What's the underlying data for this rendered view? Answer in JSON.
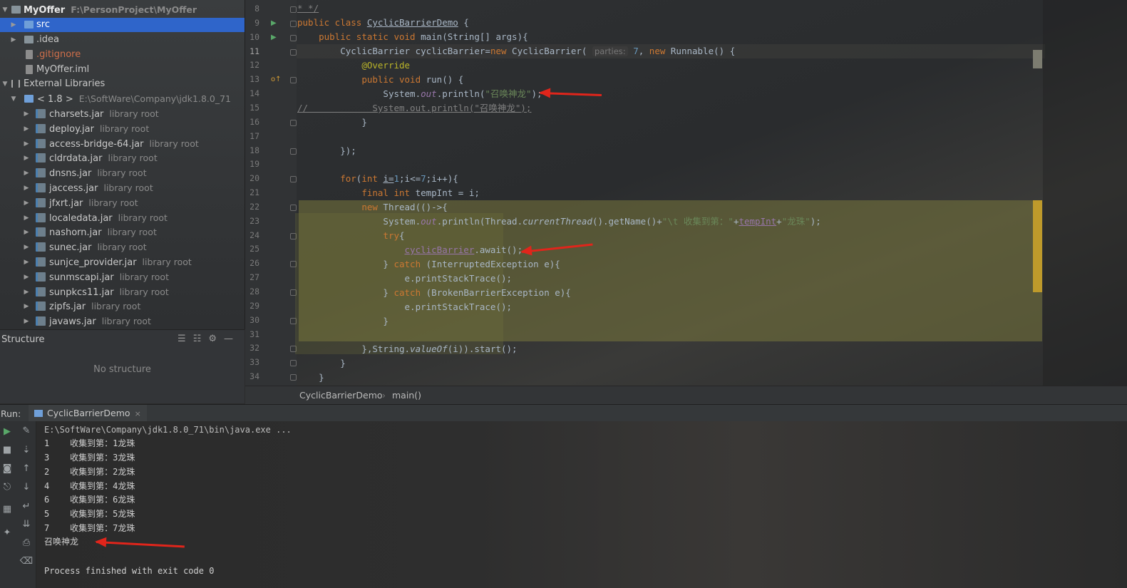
{
  "project": {
    "root_name": "MyOffer",
    "root_path": "F:\\PersonProject\\MyOffer",
    "items": [
      {
        "label": "src",
        "path": ""
      },
      {
        "label": ".idea",
        "path": ""
      },
      {
        "label": ".gitignore",
        "path": ""
      },
      {
        "label": "MyOffer.iml",
        "path": ""
      },
      {
        "label": "External Libraries",
        "path": ""
      },
      {
        "label": "< 1.8 >",
        "path": "E:\\SoftWare\\Company\\jdk1.8.0_71"
      }
    ],
    "jars": [
      {
        "label": "charsets.jar",
        "tag": "library root"
      },
      {
        "label": "deploy.jar",
        "tag": "library root"
      },
      {
        "label": "access-bridge-64.jar",
        "tag": "library root"
      },
      {
        "label": "cldrdata.jar",
        "tag": "library root"
      },
      {
        "label": "dnsns.jar",
        "tag": "library root"
      },
      {
        "label": "jaccess.jar",
        "tag": "library root"
      },
      {
        "label": "jfxrt.jar",
        "tag": "library root"
      },
      {
        "label": "localedata.jar",
        "tag": "library root"
      },
      {
        "label": "nashorn.jar",
        "tag": "library root"
      },
      {
        "label": "sunec.jar",
        "tag": "library root"
      },
      {
        "label": "sunjce_provider.jar",
        "tag": "library root"
      },
      {
        "label": "sunmscapi.jar",
        "tag": "library root"
      },
      {
        "label": "sunpkcs11.jar",
        "tag": "library root"
      },
      {
        "label": "zipfs.jar",
        "tag": "library root"
      },
      {
        "label": "javaws.jar",
        "tag": "library root"
      }
    ]
  },
  "structure": {
    "title": "Structure",
    "empty_text": "No structure"
  },
  "editor": {
    "line_numbers": [
      "8",
      "9",
      "10",
      "11",
      "12",
      "13",
      "14",
      "15",
      "16",
      "17",
      "18",
      "19",
      "20",
      "21",
      "22",
      "23",
      "24",
      "25",
      "26",
      "27",
      "28",
      "29",
      "30",
      "31",
      "32",
      "33",
      "34"
    ],
    "code": {
      "l8": "* */",
      "l9_kw": "public class ",
      "l9_cls": "CyclicBarrierDemo",
      "l9_rest": " {",
      "l10_kw": "public static void ",
      "l10_rest": "main(String[] args){",
      "l11_a": "CyclicBarrier cyclicBarrier=",
      "l11_kw": "new ",
      "l11_b": "CyclicBarrier( ",
      "l11_param": "parties:",
      "l11_num": " 7",
      "l11_c": ", ",
      "l11_kw2": "new ",
      "l11_d": "Runnable() {",
      "l12": "@Override",
      "l13_kw": "public void ",
      "l13_rest": "run() {",
      "l14_a": "System.",
      "l14_fld": "out",
      "l14_b": ".println(",
      "l14_str": "\"召唤神龙\"",
      "l14_c": ");",
      "l15": "//            System.out.println(\"召唤神龙\");",
      "l16": "}",
      "l18": "});",
      "l20_kw": "for",
      "l20_a": "(",
      "l20_kw2": "int ",
      "l20_b": "i=",
      "l20_n1": "1",
      "l20_c": ";i<=",
      "l20_n2": "7",
      "l20_d": ";i++){",
      "l21_kw": "final int ",
      "l21_rest": "tempInt = i;",
      "l22_kw": "new ",
      "l22_rest": "Thread(()->{",
      "l23_a": "System.",
      "l23_fld": "out",
      "l23_b": ".println(Thread.",
      "l23_sfn": "currentThread",
      "l23_c": "().getName()+",
      "l23_str": "\"\\t 收集到第：\"",
      "l23_d": "+",
      "l23_fld2": "tempInt",
      "l23_e": "+",
      "l23_str2": "\"龙珠\"",
      "l23_f": ");",
      "l24_kw": "try",
      "l24_rest": "{",
      "l25_a": "cyclicBarrier",
      "l25_b": ".await();",
      "l26_a": "} ",
      "l26_kw": "catch ",
      "l26_b": "(InterruptedException e){",
      "l27": "e.printStackTrace();",
      "l28_a": "} ",
      "l28_kw": "catch ",
      "l28_b": "(BrokenBarrierException e){",
      "l29": "e.printStackTrace();",
      "l30": "}",
      "l32_a": "},String.",
      "l32_sfn": "valueOf",
      "l32_b": "(i)).start();",
      "l33": "}",
      "l34": "}"
    }
  },
  "breadcrumb": {
    "class": "CyclicBarrierDemo",
    "sep": "›",
    "method": "main()"
  },
  "run": {
    "label": "Run:",
    "tab": "CyclicBarrierDemo",
    "close": "×",
    "lines": [
      "E:\\SoftWare\\Company\\jdk1.8.0_71\\bin\\java.exe ...",
      "1    收集到第：1龙珠",
      "3    收集到第：3龙珠",
      "2    收集到第：2龙珠",
      "4    收集到第：4龙珠",
      "6    收集到第：6龙珠",
      "5    收集到第：5龙珠",
      "7    收集到第：7龙珠",
      "召唤神龙",
      "",
      "Process finished with exit code 0"
    ]
  },
  "icons": {
    "run": "play-icon",
    "rerun": "rerun-icon",
    "stop": "stop-icon",
    "camera": "camera-icon",
    "exit": "exit-icon",
    "up": "up-arrow-icon",
    "down": "down-arrow-icon",
    "wrap": "soft-wrap-icon",
    "scroll": "scroll-to-end-icon",
    "print": "print-icon",
    "trash": "trash-icon",
    "pin": "pin-icon",
    "layout": "layout-icon",
    "gear": "gear-icon",
    "minimize": "minimize-icon"
  },
  "colors": {
    "selection": "#2f65ca",
    "keyword": "#cc7832",
    "string": "#6a8759",
    "annotation": "#bbb529",
    "number": "#6897bb",
    "field": "#9876aa",
    "arrow": "#e0251b"
  }
}
